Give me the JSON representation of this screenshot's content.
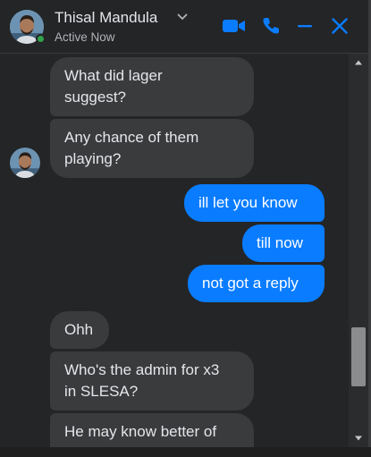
{
  "header": {
    "contact_name": "Thisal Mandula",
    "status": "Active Now",
    "accent_color": "#0a7cff",
    "online_color": "#31a24c",
    "icons": [
      "video-call-icon",
      "voice-call-icon",
      "minimize-icon",
      "close-icon",
      "chevron-down-icon"
    ]
  },
  "messages": [
    {
      "sender": "contact",
      "text": "What did lager\nsuggest?"
    },
    {
      "sender": "contact",
      "text": "Any chance of them\nplaying?"
    },
    {
      "sender": "me",
      "text": "ill let you know"
    },
    {
      "sender": "me",
      "text": "till now"
    },
    {
      "sender": "me",
      "text": "not got a reply"
    },
    {
      "sender": "contact",
      "text": "Ohh"
    },
    {
      "sender": "contact",
      "text": "Who's the admin for x3\nin SLESA?"
    },
    {
      "sender": "contact",
      "text": "He may know better of"
    }
  ],
  "colors": {
    "incoming_bubble": "#3a3b3c",
    "outgoing_bubble": "#0a7cff",
    "background": "#242526"
  }
}
